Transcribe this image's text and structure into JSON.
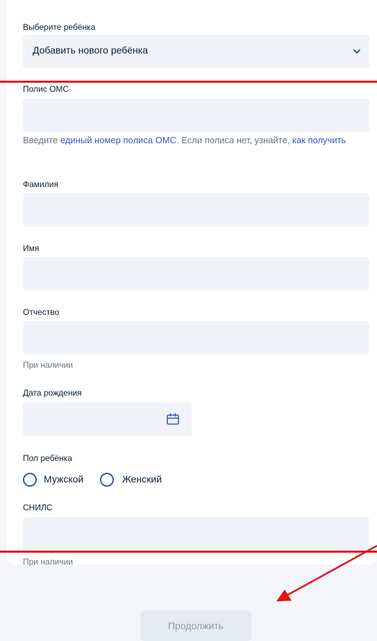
{
  "child_select": {
    "label": "Выберите ребёнка",
    "value": "Добавить нового ребёнка",
    "icon": "chevron-down-icon"
  },
  "oms": {
    "label": "Полис ОМС",
    "value": "",
    "hint_prefix": "Введите ",
    "hint_link1": "единый номер полиса ОМС",
    "hint_middle": ". Если полиса нет, узнайте, ",
    "hint_link2": "как получить"
  },
  "surname": {
    "label": "Фамилия",
    "value": ""
  },
  "name": {
    "label": "Имя",
    "value": ""
  },
  "patronymic": {
    "label": "Отчество",
    "value": "",
    "hint": "При наличии"
  },
  "birthdate": {
    "label": "Дата рождения",
    "value": "",
    "icon": "calendar-icon"
  },
  "gender": {
    "label": "Пол ребёнка",
    "options": [
      "Мужской",
      "Женский"
    ],
    "selected": null
  },
  "snils": {
    "label": "СНИЛС",
    "value": "",
    "hint": "При наличии"
  },
  "continue_button": {
    "label": "Продолжить",
    "disabled": true
  },
  "colors": {
    "accent": "#3755c4",
    "field_bg": "#f0f3f7",
    "annotation": "#e11515"
  }
}
